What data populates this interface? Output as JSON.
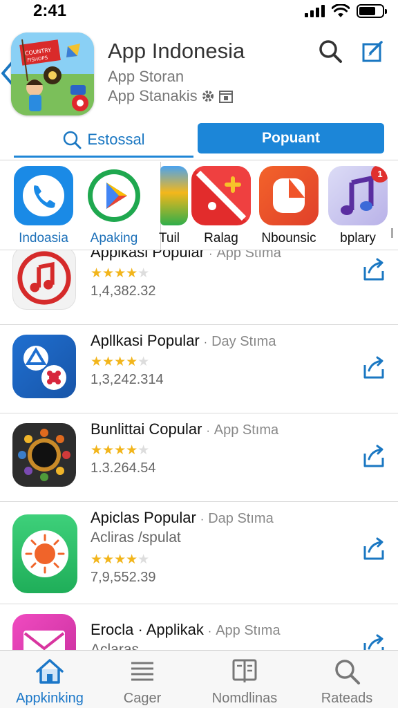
{
  "status_bar": {
    "time": "2:41",
    "battery_level": 0.72
  },
  "header": {
    "title": "App Indonesia",
    "subtitle_1": "App Storan",
    "subtitle_2": "App Stanakis",
    "hero_icon_text_1": "COUNTRY",
    "hero_icon_text_2": "FISHOPS"
  },
  "segments": {
    "left_label": "Estossal",
    "right_label": "Popuant"
  },
  "categories": [
    {
      "label": "Indoasia",
      "color": "#1a8ae6"
    },
    {
      "label": "Apaking",
      "color": "#1fa84f"
    },
    {
      "label": "Tuil",
      "color": "#f3b71b"
    },
    {
      "label": "Ralag",
      "color": "#e22c2c"
    },
    {
      "label": "Nbounsic",
      "color": "#f05a22"
    },
    {
      "label": "bplary",
      "color": "#6b3fa6",
      "badge": "1"
    }
  ],
  "apps": [
    {
      "name": "Applkasi Popular",
      "meta": "App Stıma",
      "rating": 4.5,
      "count": "1,4,382.32"
    },
    {
      "name": "Apllkasi Popular",
      "meta": "Day Stıma",
      "rating": 4.5,
      "count": "1,3,242.314"
    },
    {
      "name": "Bunlittai Copular",
      "meta": "App Stıma",
      "rating": 4.5,
      "count": "1.3.264.54"
    },
    {
      "name": "Apiclas Popular",
      "meta": "Dap Stıma",
      "sub": "Acliras /spulat",
      "rating": 4.5,
      "count": "7,9,552.39"
    },
    {
      "name": "Erocla · Applikak",
      "meta": "App Stıma",
      "sub": "Aclaras"
    }
  ],
  "tabbar": [
    {
      "label": "Appkinking",
      "icon": "home-icon",
      "active": true
    },
    {
      "label": "Cager",
      "icon": "menu-lines-icon"
    },
    {
      "label": "Nomdlinas",
      "icon": "book-icon"
    },
    {
      "label": "Rateads",
      "icon": "search-icon"
    }
  ],
  "colors": {
    "accent": "#1c86d8",
    "star": "#f2b51b"
  }
}
